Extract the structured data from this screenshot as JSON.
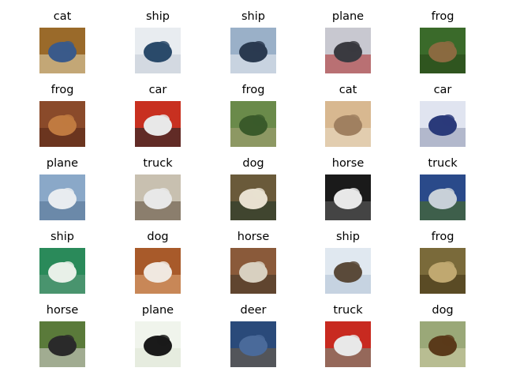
{
  "grid": {
    "columns": 5,
    "rows": 5,
    "items": [
      {
        "label": "cat",
        "icon": "cat-thumbnail",
        "colors": [
          "#9a6a2a",
          "#3a5a8a",
          "#d8c8a0"
        ]
      },
      {
        "label": "ship",
        "icon": "ship-thumbnail",
        "colors": [
          "#e8ecf0",
          "#2a4a6a",
          "#c8d0d8"
        ]
      },
      {
        "label": "ship",
        "icon": "ship-thumbnail",
        "colors": [
          "#9ab0c8",
          "#2a3a50",
          "#e0e6ec"
        ]
      },
      {
        "label": "plane",
        "icon": "plane-thumbnail",
        "colors": [
          "#c8c8d0",
          "#3a3a40",
          "#b04040"
        ]
      },
      {
        "label": "frog",
        "icon": "frog-thumbnail",
        "colors": [
          "#3a6a2a",
          "#8a6a40",
          "#2a4a1a"
        ]
      },
      {
        "label": "frog",
        "icon": "frog-thumbnail",
        "colors": [
          "#8a4a2a",
          "#c07a40",
          "#5a2a1a"
        ]
      },
      {
        "label": "car",
        "icon": "car-thumbnail",
        "colors": [
          "#c83020",
          "#e8e8e8",
          "#2a2a2a"
        ]
      },
      {
        "label": "frog",
        "icon": "frog-thumbnail",
        "colors": [
          "#6a8a4a",
          "#3a5a2a",
          "#a0a070"
        ]
      },
      {
        "label": "cat",
        "icon": "cat-thumbnail",
        "colors": [
          "#d8b890",
          "#a08060",
          "#e8d8c0"
        ]
      },
      {
        "label": "car",
        "icon": "car-thumbnail",
        "colors": [
          "#e0e4f0",
          "#2a3a7a",
          "#9aa0b8"
        ]
      },
      {
        "label": "plane",
        "icon": "plane-thumbnail",
        "colors": [
          "#8aa8c8",
          "#e8ecf0",
          "#5a7898"
        ]
      },
      {
        "label": "truck",
        "icon": "truck-thumbnail",
        "colors": [
          "#c8c0b0",
          "#e8e8e8",
          "#6a5a4a"
        ]
      },
      {
        "label": "dog",
        "icon": "dog-thumbnail",
        "colors": [
          "#6a5a3a",
          "#e8e0d0",
          "#2a3a2a"
        ]
      },
      {
        "label": "horse",
        "icon": "horse-thumbnail",
        "colors": [
          "#1a1a1a",
          "#e8e8e8",
          "#5a5a5a"
        ]
      },
      {
        "label": "truck",
        "icon": "truck-thumbnail",
        "colors": [
          "#2a4a8a",
          "#c8d0d8",
          "#4a6a2a"
        ]
      },
      {
        "label": "ship",
        "icon": "ship-thumbnail",
        "colors": [
          "#2a8a5a",
          "#e8f0e8",
          "#5a9a7a"
        ]
      },
      {
        "label": "dog",
        "icon": "dog-thumbnail",
        "colors": [
          "#a85a2a",
          "#f0e8e0",
          "#d8a070"
        ]
      },
      {
        "label": "horse",
        "icon": "horse-thumbnail",
        "colors": [
          "#8a5a3a",
          "#d8d0c0",
          "#4a3a2a"
        ]
      },
      {
        "label": "ship",
        "icon": "ship-thumbnail",
        "colors": [
          "#e0e8f0",
          "#5a4a3a",
          "#b8c8d8"
        ]
      },
      {
        "label": "frog",
        "icon": "frog-thumbnail",
        "colors": [
          "#7a6a3a",
          "#c0a870",
          "#4a3a1a"
        ]
      },
      {
        "label": "horse",
        "icon": "horse-thumbnail",
        "colors": [
          "#5a7a3a",
          "#2a2a2a",
          "#c8c8c0"
        ]
      },
      {
        "label": "plane",
        "icon": "plane-thumbnail",
        "colors": [
          "#f0f4ec",
          "#1a1a1a",
          "#e0e8d8"
        ]
      },
      {
        "label": "deer",
        "icon": "deer-thumbnail",
        "colors": [
          "#2a4a7a",
          "#4a6a9a",
          "#6a5a4a"
        ]
      },
      {
        "label": "truck",
        "icon": "truck-thumbnail",
        "colors": [
          "#c82a20",
          "#e8e8e8",
          "#7a8a7a"
        ]
      },
      {
        "label": "dog",
        "icon": "dog-thumbnail",
        "colors": [
          "#9aa878",
          "#5a3a1a",
          "#c8c8a0"
        ]
      }
    ]
  }
}
